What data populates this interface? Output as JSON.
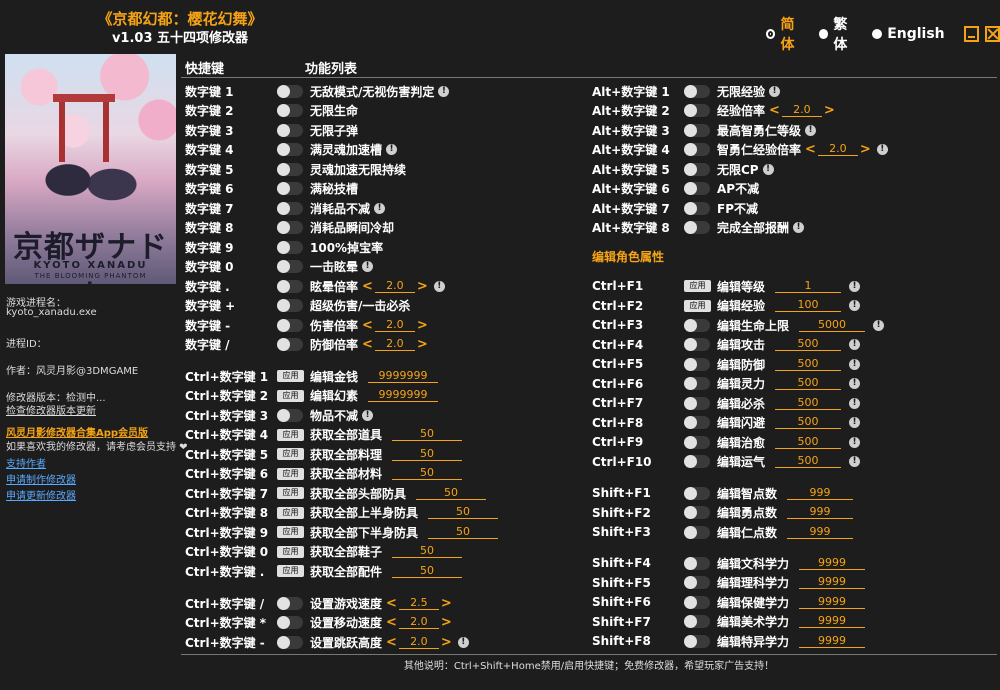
{
  "header": {
    "game_title": "《京都幻都：樱花幻舞》",
    "subtitle": "v1.03 五十四项修改器",
    "languages": [
      {
        "label": "简体",
        "selected": true
      },
      {
        "label": "繁体",
        "selected": false
      },
      {
        "label": "English",
        "selected": false
      }
    ],
    "minimize_icon": "minimize-icon",
    "close_icon": "close-icon"
  },
  "cover": {
    "logo_text": "京都ザナドゥ",
    "logo_sub": "KYOTO XANADU",
    "logo_tagline": "THE BLOOMING PHANTOM"
  },
  "sidebar": {
    "process_label": "游戏进程名：",
    "process_name": "kyoto_xanadu.exe",
    "pid_label": "进程ID：",
    "author": "作者：风灵月影@3DMGAME",
    "version_label": "修改器版本：检测中...",
    "check_update": "检查修改器版本更新",
    "membership": "风灵月影修改器合集App会员版",
    "support_text": "如果喜欢我的修改器，请考虑会员支持 ❤",
    "link_support": "支持作者",
    "link_request": "申请制作修改器",
    "link_update": "申请更新修改器"
  },
  "columns": {
    "hotkey": "快捷键",
    "features": "功能列表"
  },
  "colors": {
    "accent": "#f5a316",
    "background": "#1d1d1d",
    "link": "#5aa9ff"
  },
  "left_rows": [
    {
      "hotkey": "数字键 1",
      "control": "toggle",
      "label": "无敌模式/无视伤害判定",
      "info": true
    },
    {
      "hotkey": "数字键 2",
      "control": "toggle",
      "label": "无限生命"
    },
    {
      "hotkey": "数字键 3",
      "control": "toggle",
      "label": "无限子弹"
    },
    {
      "hotkey": "数字键 4",
      "control": "toggle",
      "label": "满灵魂加速槽",
      "info": true
    },
    {
      "hotkey": "数字键 5",
      "control": "toggle",
      "label": "灵魂加速无限持续"
    },
    {
      "hotkey": "数字键 6",
      "control": "toggle",
      "label": "满秘技槽"
    },
    {
      "hotkey": "数字键 7",
      "control": "toggle",
      "label": "消耗品不减",
      "info": true
    },
    {
      "hotkey": "数字键 8",
      "control": "toggle",
      "label": "消耗品瞬间冷却"
    },
    {
      "hotkey": "数字键 9",
      "control": "toggle",
      "label": "100%掉宝率"
    },
    {
      "hotkey": "数字键 0",
      "control": "toggle",
      "label": "一击眩晕",
      "info": true
    },
    {
      "hotkey": "数字键 .",
      "control": "toggle",
      "label": "眩晕倍率",
      "value": "2.0",
      "spinner": true,
      "info": true
    },
    {
      "hotkey": "数字键 +",
      "control": "toggle",
      "label": "超级伤害/一击必杀"
    },
    {
      "hotkey": "数字键 -",
      "control": "toggle",
      "label": "伤害倍率",
      "value": "2.0",
      "spinner": true
    },
    {
      "hotkey": "数字键 /",
      "control": "toggle",
      "label": "防御倍率",
      "value": "2.0",
      "spinner": true
    },
    {
      "hotkey": "Ctrl+数字键 1",
      "control": "apply",
      "label": "编辑金钱",
      "value": "9999999",
      "vw": 70
    },
    {
      "hotkey": "Ctrl+数字键 2",
      "control": "apply",
      "label": "编辑幻素",
      "value": "9999999",
      "vw": 70
    },
    {
      "hotkey": "Ctrl+数字键 3",
      "control": "toggle",
      "label": "物品不减",
      "info": true
    },
    {
      "hotkey": "Ctrl+数字键 4",
      "control": "apply",
      "label": "获取全部道具",
      "value": "50",
      "vw": 70
    },
    {
      "hotkey": "Ctrl+数字键 5",
      "control": "apply",
      "label": "获取全部料理",
      "value": "50",
      "vw": 70
    },
    {
      "hotkey": "Ctrl+数字键 6",
      "control": "apply",
      "label": "获取全部材料",
      "value": "50",
      "vw": 70
    },
    {
      "hotkey": "Ctrl+数字键 7",
      "control": "apply",
      "label": "获取全部头部防具",
      "value": "50",
      "vw": 70
    },
    {
      "hotkey": "Ctrl+数字键 8",
      "control": "apply",
      "label": "获取全部上半身防具",
      "value": "50",
      "vw": 70
    },
    {
      "hotkey": "Ctrl+数字键 9",
      "control": "apply",
      "label": "获取全部下半身防具",
      "value": "50",
      "vw": 70
    },
    {
      "hotkey": "Ctrl+数字键 0",
      "control": "apply",
      "label": "获取全部鞋子",
      "value": "50",
      "vw": 70
    },
    {
      "hotkey": "Ctrl+数字键 .",
      "control": "apply",
      "label": "获取全部配件",
      "value": "50",
      "vw": 70
    },
    {
      "hotkey": "Ctrl+数字键 /",
      "control": "toggle",
      "label": "设置游戏速度",
      "value": "2.5",
      "spinner": true
    },
    {
      "hotkey": "Ctrl+数字键 *",
      "control": "toggle",
      "label": "设置移动速度",
      "value": "2.0",
      "spinner": true
    },
    {
      "hotkey": "Ctrl+数字键 -",
      "control": "toggle",
      "label": "设置跳跃高度",
      "value": "2.0",
      "spinner": true,
      "info": true
    }
  ],
  "right_section_title": "编辑角色属性",
  "right_rows": [
    {
      "hotkey": "Alt+数字键 1",
      "control": "toggle",
      "label": "无限经验",
      "info": true
    },
    {
      "hotkey": "Alt+数字键 2",
      "control": "toggle",
      "label": "经验倍率",
      "value": "2.0",
      "spinner": true
    },
    {
      "hotkey": "Alt+数字键 3",
      "control": "toggle",
      "label": "最高智勇仁等级",
      "info": true
    },
    {
      "hotkey": "Alt+数字键 4",
      "control": "toggle",
      "label": "智勇仁经验倍率",
      "value": "2.0",
      "spinner": true,
      "info": true
    },
    {
      "hotkey": "Alt+数字键 5",
      "control": "toggle",
      "label": "无限CP",
      "info": true
    },
    {
      "hotkey": "Alt+数字键 6",
      "control": "toggle",
      "label": "AP不减"
    },
    {
      "hotkey": "Alt+数字键 7",
      "control": "toggle",
      "label": "FP不减"
    },
    {
      "hotkey": "Alt+数字键 8",
      "control": "toggle",
      "label": "完成全部报酬",
      "info": true
    },
    {
      "hotkey": "Ctrl+F1",
      "control": "apply",
      "label": "编辑等级",
      "value": "1",
      "vw": 66,
      "info": true
    },
    {
      "hotkey": "Ctrl+F2",
      "control": "apply",
      "label": "编辑经验",
      "value": "100",
      "vw": 66,
      "info": true
    },
    {
      "hotkey": "Ctrl+F3",
      "control": "toggle",
      "label": "编辑生命上限",
      "value": "5000",
      "vw": 66,
      "info": true
    },
    {
      "hotkey": "Ctrl+F4",
      "control": "toggle",
      "label": "编辑攻击",
      "value": "500",
      "vw": 66,
      "info": true
    },
    {
      "hotkey": "Ctrl+F5",
      "control": "toggle",
      "label": "编辑防御",
      "value": "500",
      "vw": 66,
      "info": true
    },
    {
      "hotkey": "Ctrl+F6",
      "control": "toggle",
      "label": "编辑灵力",
      "value": "500",
      "vw": 66,
      "info": true
    },
    {
      "hotkey": "Ctrl+F7",
      "control": "toggle",
      "label": "编辑必杀",
      "value": "500",
      "vw": 66,
      "info": true
    },
    {
      "hotkey": "Ctrl+F8",
      "control": "toggle",
      "label": "编辑闪避",
      "value": "500",
      "vw": 66,
      "info": true
    },
    {
      "hotkey": "Ctrl+F9",
      "control": "toggle",
      "label": "编辑治愈",
      "value": "500",
      "vw": 66,
      "info": true
    },
    {
      "hotkey": "Ctrl+F10",
      "control": "toggle",
      "label": "编辑运气",
      "value": "500",
      "vw": 66,
      "info": true
    },
    {
      "hotkey": "Shift+F1",
      "control": "toggle",
      "label": "编辑智点数",
      "value": "999",
      "vw": 66
    },
    {
      "hotkey": "Shift+F2",
      "control": "toggle",
      "label": "编辑勇点数",
      "value": "999",
      "vw": 66
    },
    {
      "hotkey": "Shift+F3",
      "control": "toggle",
      "label": "编辑仁点数",
      "value": "999",
      "vw": 66
    },
    {
      "hotkey": "Shift+F4",
      "control": "toggle",
      "label": "编辑文科学力",
      "value": "9999",
      "vw": 66
    },
    {
      "hotkey": "Shift+F5",
      "control": "toggle",
      "label": "编辑理科学力",
      "value": "9999",
      "vw": 66
    },
    {
      "hotkey": "Shift+F6",
      "control": "toggle",
      "label": "编辑保健学力",
      "value": "9999",
      "vw": 66
    },
    {
      "hotkey": "Shift+F7",
      "control": "toggle",
      "label": "编辑美术学力",
      "value": "9999",
      "vw": 66
    },
    {
      "hotkey": "Shift+F8",
      "control": "toggle",
      "label": "编辑特异学力",
      "value": "9999",
      "vw": 66
    }
  ],
  "buttons": {
    "apply_label": "应用",
    "info_glyph": "!",
    "arrow_left": "<",
    "arrow_right": ">"
  },
  "footer": "其他说明：Ctrl+Shift+Home禁用/启用快捷键；免费修改器，希望玩家广告支持！"
}
